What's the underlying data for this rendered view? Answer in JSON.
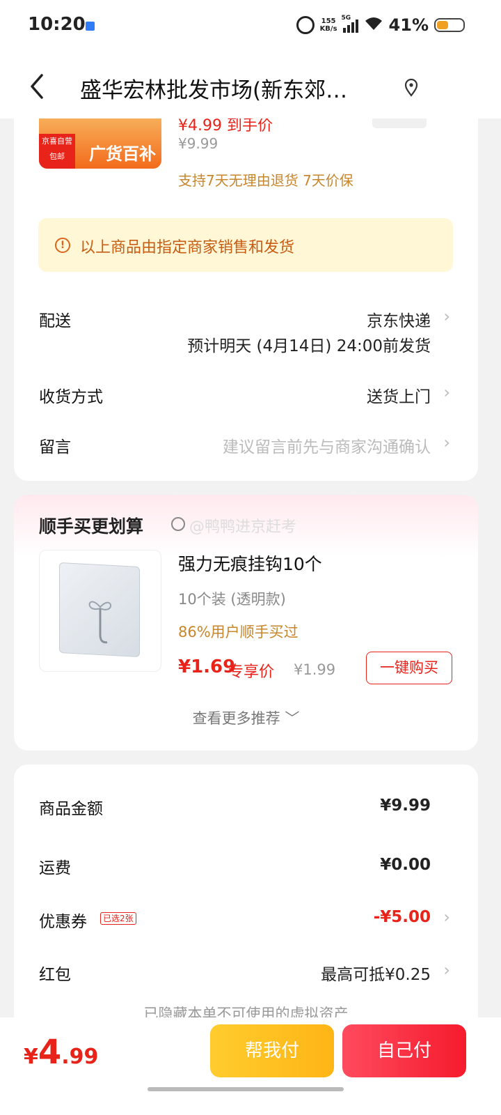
{
  "status_bar": {
    "time": "10:20",
    "net_speed": [
      "155",
      "KB/s"
    ],
    "network": "5G",
    "battery": "41%"
  },
  "nav": {
    "title": "盛华宏林批发市场(新东郊…"
  },
  "product": {
    "image_badge": "京喜自营\n包邮",
    "image_banner": "广货百补",
    "price_cut_text": "¥4.99 到手价",
    "original_price": "¥9.99",
    "policy": "支持7天无理由退货  7天价保"
  },
  "notice": {
    "text": "以上商品由指定商家销售和发货"
  },
  "delivery": {
    "label": "配送",
    "value": "京东快递",
    "eta": "预计明天 (4月14日) 24:00前发货"
  },
  "receive": {
    "label": "收货方式",
    "value": "送货上门"
  },
  "message": {
    "label": "留言",
    "placeholder": "建议留言前先与商家沟通确认"
  },
  "recommend": {
    "title": "顺手买更划算",
    "watermark": "@鸭鸭进京赶考",
    "item": {
      "name": "强力无痕挂钩10个",
      "spec": "10个装 (透明款)",
      "stat": "86%用户顺手买过",
      "price": "¥1.69",
      "price_tag": "专享价",
      "orig_price": "¥1.99",
      "buy_label": "一键购买"
    },
    "more_label": "查看更多推荐 ﹀"
  },
  "summary": {
    "goods": {
      "label": "商品金额",
      "value": "¥9.99"
    },
    "shipping": {
      "label": "运费",
      "value": "¥0.00"
    },
    "coupon": {
      "label": "优惠券",
      "badge": "已选2张",
      "value": "-¥5.00"
    },
    "redpacket": {
      "label": "红包",
      "value": "最高可抵¥0.25"
    },
    "cut_note": "已隐藏本单不可使用的虚拟资产"
  },
  "footer": {
    "currency": "¥",
    "total_int": "4",
    "total_dec": ".99",
    "help_pay_label": "帮我付",
    "self_pay_label": "自己付"
  },
  "colors": {
    "accent_red": "#e8231a",
    "policy_gold": "#c8862b",
    "notice_bg": "#fff7d6",
    "help_btn": "#ffc21f",
    "self_btn": "#f7283a"
  }
}
